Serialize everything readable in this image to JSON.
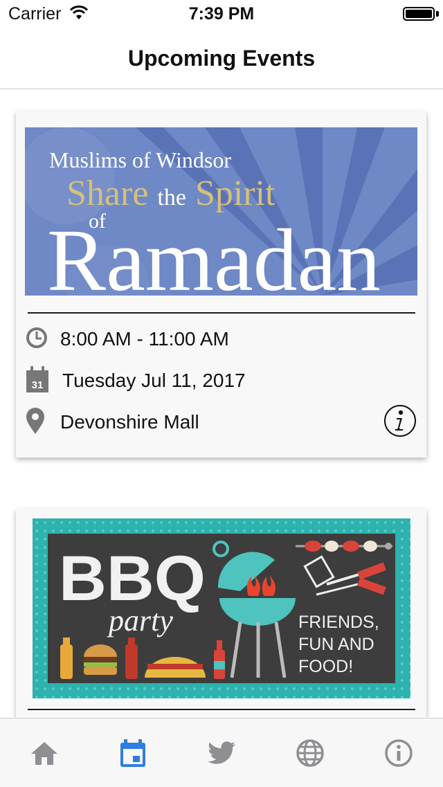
{
  "status_bar": {
    "carrier": "Carrier",
    "time": "7:39 PM"
  },
  "header": {
    "title": "Upcoming Events"
  },
  "events": [
    {
      "banner": {
        "line1": "Muslims of Windsor",
        "line2a": "Share",
        "line2b": "the",
        "line2c": "Spirit",
        "line3": "of",
        "line4": "Ramadan"
      },
      "time": "8:00 AM - 11:00 AM",
      "calendar_day": "31",
      "date": "Tuesday Jul 11, 2017",
      "location": "Devonshire Mall"
    },
    {
      "banner": {
        "title": "BBQ",
        "subtitle": "party",
        "tag1": "FRIENDS,",
        "tag2": "FUN AND",
        "tag3": "FOOD!"
      }
    }
  ],
  "tabs": [
    {
      "icon": "home-icon",
      "active": false
    },
    {
      "icon": "calendar-icon",
      "active": true
    },
    {
      "icon": "twitter-icon",
      "active": false
    },
    {
      "icon": "globe-icon",
      "active": false
    },
    {
      "icon": "info-icon",
      "active": false
    }
  ],
  "colors": {
    "active_tab": "#2f7dde",
    "inactive_tab": "#8e8e93",
    "ramadan_bg": "#6f88c6",
    "ramadan_gold": "#d6c07a",
    "bbq_teal": "#2db2ad",
    "bbq_board": "#3d3d3d"
  }
}
